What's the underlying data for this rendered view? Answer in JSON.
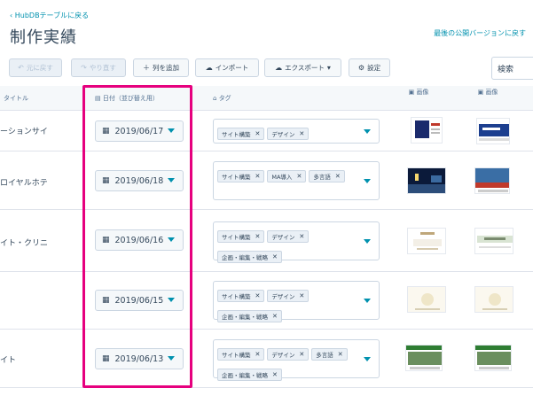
{
  "header": {
    "back_link": "‹ HubDBテーブルに戻る",
    "title": "制作実績",
    "revert_link": "最後の公開バージョンに戻す"
  },
  "toolbar": {
    "undo": "元に戻す",
    "redo": "やり直す",
    "add_column": "列を追加",
    "import": "インポート",
    "export": "エクスポート",
    "settings": "設定",
    "search_placeholder": "検索"
  },
  "columns": {
    "name": "タイトル",
    "date": "日付（並び替え用）",
    "tags": "タグ",
    "image1": "画像",
    "image2": "画像"
  },
  "rows": [
    {
      "name": "ーションサイ",
      "date": "2019/06/17",
      "tags": [
        "サイト構築",
        "デザイン"
      ]
    },
    {
      "name": "ロイヤルホテ",
      "date": "2019/06/18",
      "tags": [
        "サイト構築",
        "MA導入",
        "多言語"
      ]
    },
    {
      "name": "イト・クリニ",
      "date": "2019/06/16",
      "tags": [
        "サイト構築",
        "デザイン",
        "企画・編集・戦略"
      ]
    },
    {
      "name": "",
      "date": "2019/06/15",
      "tags": [
        "サイト構築",
        "デザイン",
        "企画・編集・戦略"
      ]
    },
    {
      "name": "イト",
      "date": "2019/06/13",
      "tags": [
        "サイト構築",
        "デザイン",
        "多言語",
        "企画・編集・戦略"
      ]
    }
  ],
  "colors": {
    "accent": "#0091ae",
    "highlight": "#e6007e",
    "text": "#33475b"
  }
}
